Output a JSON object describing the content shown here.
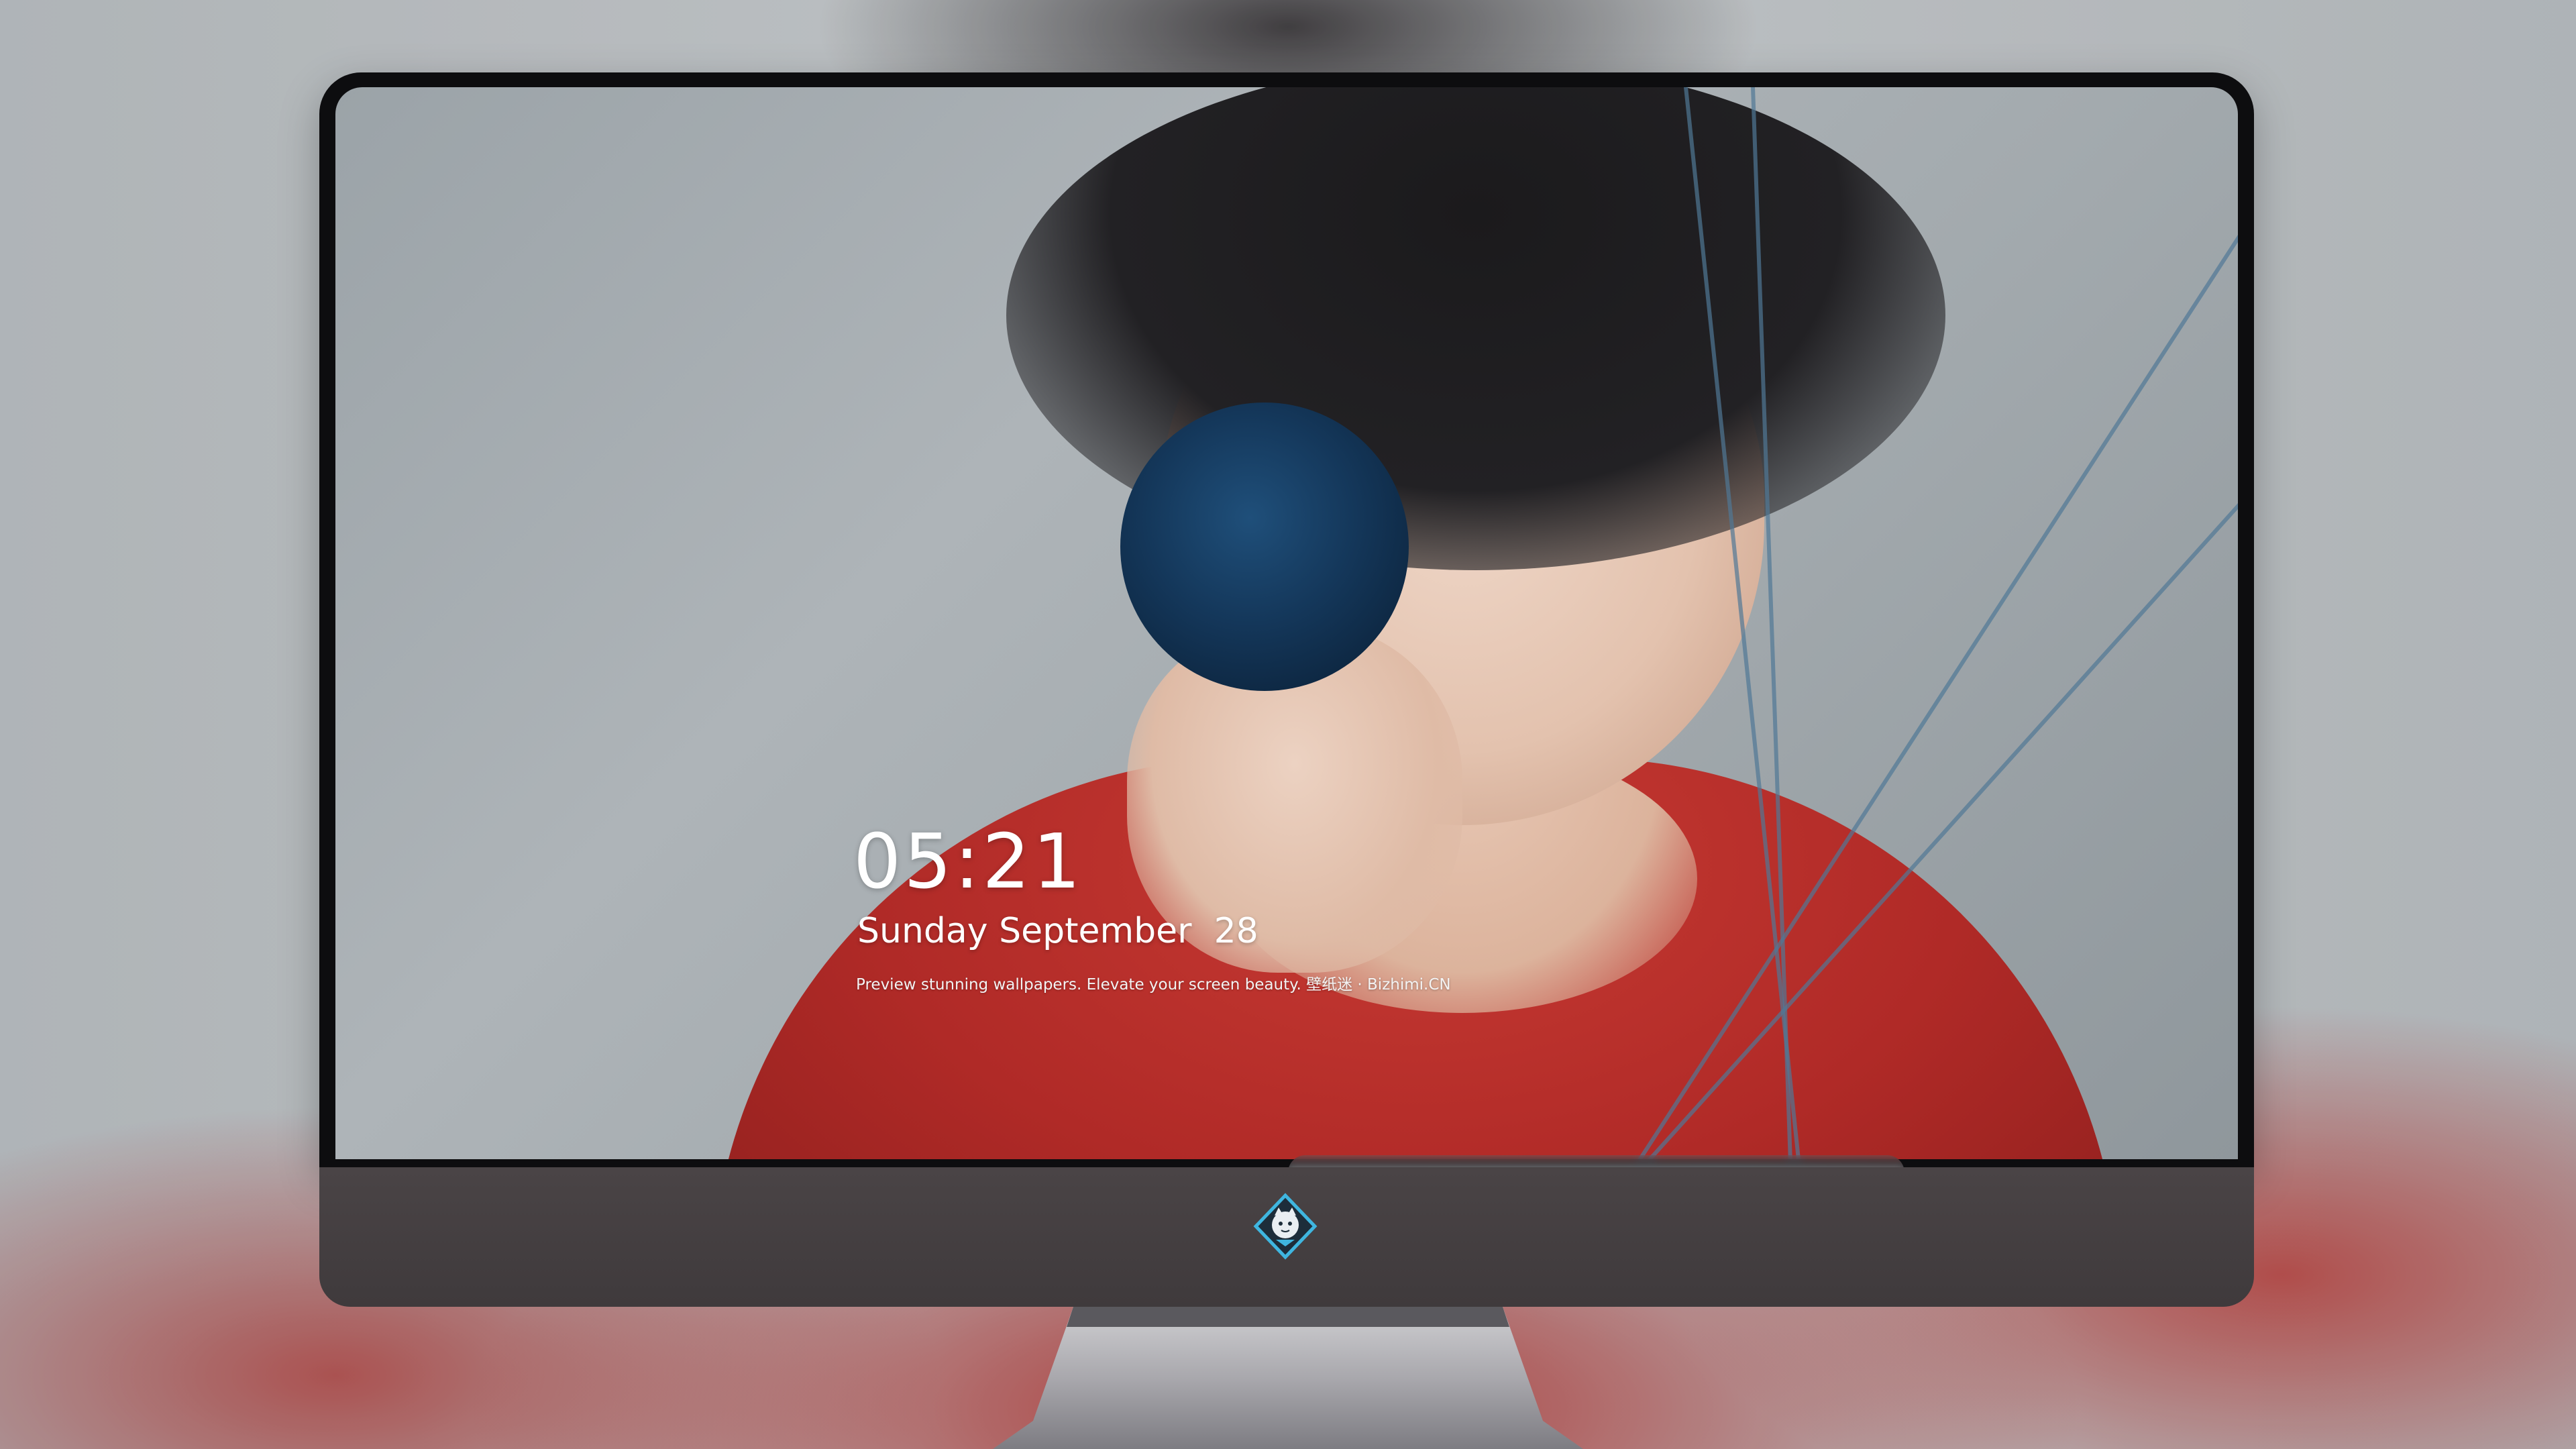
{
  "lockscreen": {
    "time": "05:21",
    "date": "Sunday September  28",
    "tagline": "Preview stunning wallpapers. Elevate your screen beauty. 壁纸迷 · Bizhimi.CN"
  },
  "dock": {
    "apps": [
      {
        "name": "messages-app",
        "color": "#34c759"
      },
      {
        "name": "weather-app",
        "color": "#2f8ef0"
      },
      {
        "name": "clock-app",
        "color": "#1c1c1e"
      },
      {
        "name": "preview-app",
        "color": "#f2c94c"
      },
      {
        "name": "clips-app",
        "color": "#5ac8fa"
      },
      {
        "name": "notes-app",
        "color": "#ffd84d"
      },
      {
        "name": "photo-grid-app",
        "color": "#5fb2e6"
      },
      {
        "name": "music-app",
        "color": "#fa5cc1"
      },
      {
        "name": "app-store-app",
        "color": "#1a8cff"
      },
      {
        "name": "camera-app",
        "color": "#8e8e93"
      }
    ]
  },
  "colors": {
    "bezel": "#0d0d0f",
    "chin": "#433d3f",
    "accent": "#2f8ef0"
  }
}
